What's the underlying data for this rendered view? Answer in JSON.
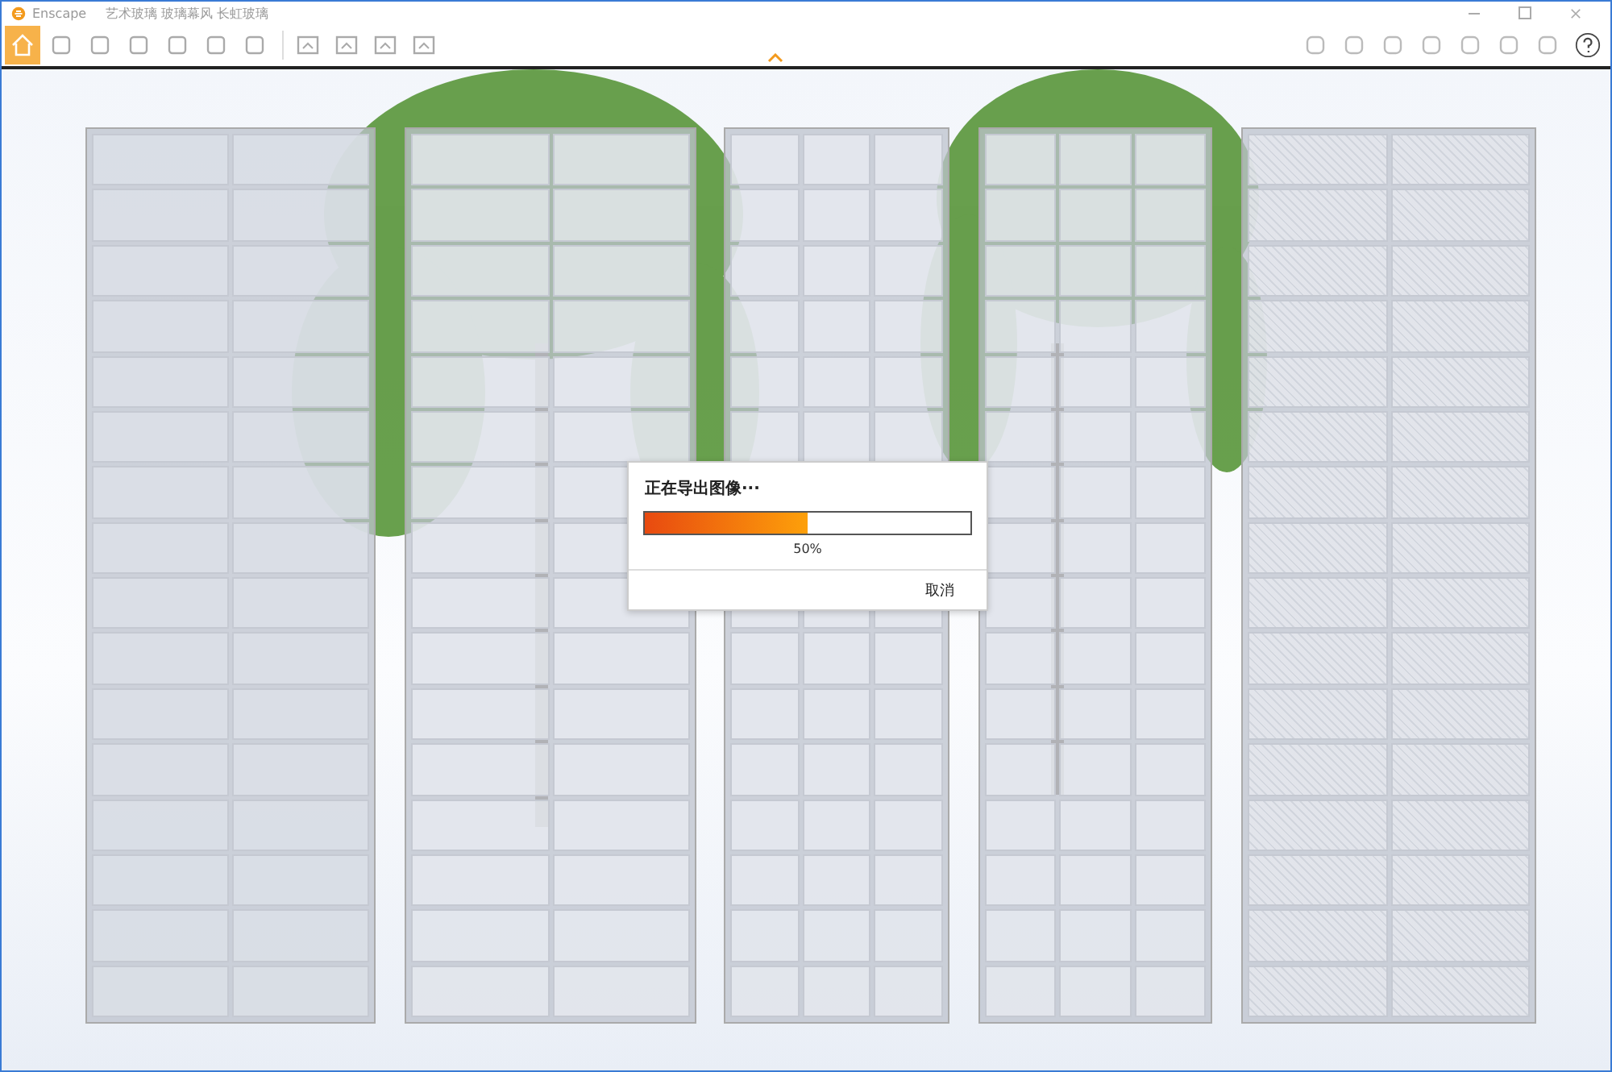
{
  "window": {
    "app": "Enscape",
    "title": "艺术玻璃 玻璃幕风 长虹玻璃"
  },
  "toolbar": {
    "tools": [
      {
        "selected": true
      },
      {
        "selected": false
      },
      {
        "selected": false
      },
      {
        "selected": false
      },
      {
        "selected": false
      },
      {
        "selected": false
      },
      {
        "selected": false
      }
    ]
  },
  "dialog": {
    "title": "正在导出图像···",
    "progress": {
      "level": 0.5,
      "reading": "50%"
    },
    "buttons": [
      "取消"
    ]
  }
}
